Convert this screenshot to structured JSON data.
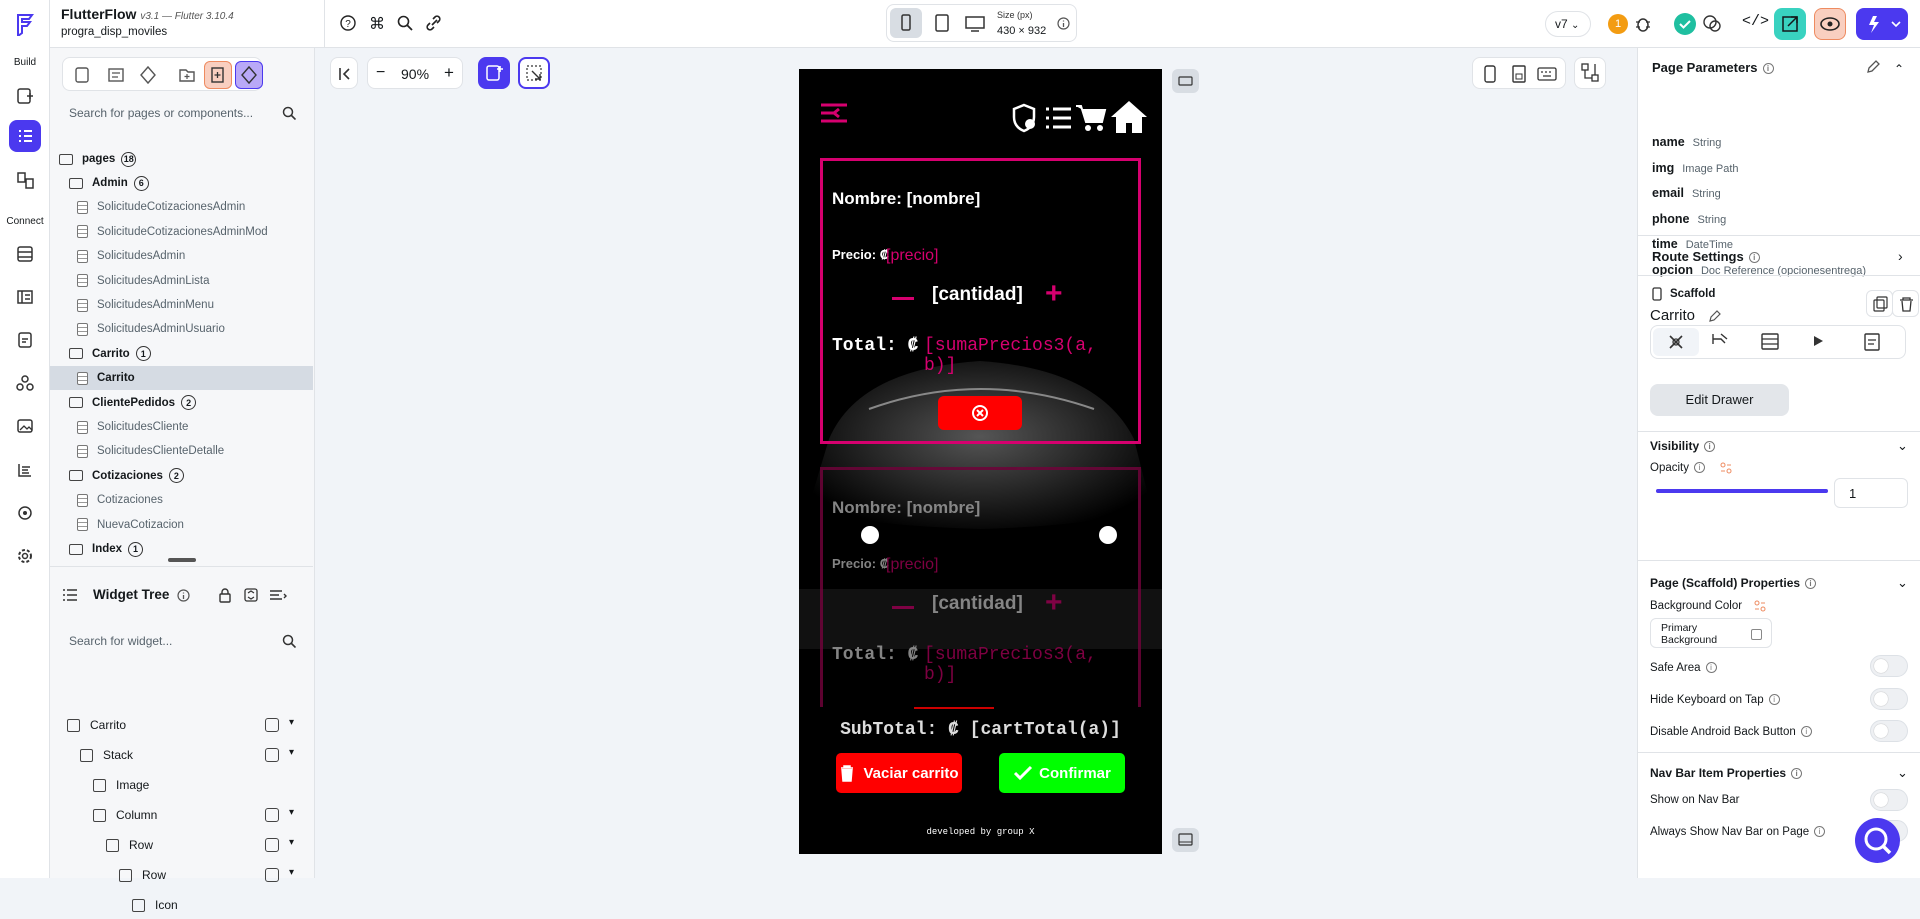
{
  "app": {
    "name": "FlutterFlow",
    "version": "v3.1 — Flutter 3.10.4",
    "project": "progra_disp_moviles"
  },
  "rail": {
    "build": "Build",
    "connect": "Connect"
  },
  "topbar": {
    "size_label": "Size (px)",
    "size_value": "430 × 932",
    "version": "v7",
    "notif_count": "1"
  },
  "pages": {
    "search_placeholder": "Search for pages or components...",
    "root_label": "pages",
    "root_count": "18",
    "items": [
      {
        "kind": "folder",
        "label": "Admin",
        "count": "6"
      },
      {
        "kind": "page",
        "label": "SolicitudeCotizacionesAdmin"
      },
      {
        "kind": "page",
        "label": "SolicitudeCotizacionesAdminMod"
      },
      {
        "kind": "page",
        "label": "SolicitudesAdmin"
      },
      {
        "kind": "page",
        "label": "SolicitudesAdminLista"
      },
      {
        "kind": "page",
        "label": "SolicitudesAdminMenu"
      },
      {
        "kind": "page",
        "label": "SolicitudesAdminUsuario"
      },
      {
        "kind": "folder",
        "label": "Carrito",
        "count": "1"
      },
      {
        "kind": "page",
        "label": "Carrito",
        "selected": true
      },
      {
        "kind": "folder",
        "label": "ClientePedidos",
        "count": "2"
      },
      {
        "kind": "page",
        "label": "SolicitudesCliente"
      },
      {
        "kind": "page",
        "label": "SolicitudesClienteDetalle"
      },
      {
        "kind": "folder",
        "label": "Cotizaciones",
        "count": "2"
      },
      {
        "kind": "page",
        "label": "Cotizaciones"
      },
      {
        "kind": "page",
        "label": "NuevaCotizacion"
      },
      {
        "kind": "folder",
        "label": "Index",
        "count": "1"
      }
    ]
  },
  "widget_tree": {
    "title": "Widget Tree",
    "search_placeholder": "Search for widget...",
    "items": [
      {
        "label": "Carrito",
        "icon": "phone-icon",
        "indent": 0
      },
      {
        "label": "Stack",
        "icon": "stack-icon",
        "indent": 1
      },
      {
        "label": "Image",
        "icon": "image-icon",
        "indent": 2
      },
      {
        "label": "Column",
        "icon": "column-icon",
        "indent": 2
      },
      {
        "label": "Row",
        "icon": "row-icon",
        "indent": 3
      },
      {
        "label": "Row",
        "icon": "row-icon",
        "indent": 4
      },
      {
        "label": "Icon",
        "icon": "gear-icon",
        "indent": 5
      }
    ]
  },
  "canvas": {
    "zoom": "90%"
  },
  "phone": {
    "card1": {
      "nombre": "Nombre: [nombre]",
      "precio_label": "Precio:",
      "colon_sign": "₡",
      "precio_value": "[precio]",
      "cantidad": "[cantidad]",
      "total_label": "Total:",
      "total_value": "[sumaPrecios3(a, b)]"
    },
    "card2": {
      "nombre": "Nombre: [nombre]",
      "precio_label": "Precio:",
      "precio_value": "[precio]",
      "cantidad": "[cantidad]",
      "total_label": "Total:",
      "total_value": "[sumaPrecios3(a, b)]"
    },
    "subtotal": "SubTotal: ₡ [cartTotal(a)]",
    "vaciar": "Vaciar carrito",
    "confirmar": "Confirmar",
    "footer": "developed by group X",
    "colors": {
      "accent": "#d6006f",
      "red": "#ff0000",
      "green": "#00ff00"
    }
  },
  "right": {
    "page_params_title": "Page Parameters",
    "params": [
      {
        "name": "name",
        "type": "String"
      },
      {
        "name": "img",
        "type": "Image Path"
      },
      {
        "name": "email",
        "type": "String"
      },
      {
        "name": "phone",
        "type": "String"
      },
      {
        "name": "time",
        "type": "DateTime"
      },
      {
        "name": "opcion",
        "type": "Doc Reference (opcionesentrega)"
      }
    ],
    "route_settings": "Route Settings",
    "scaffold_label": "Scaffold",
    "scaffold_name": "Carrito",
    "edit_drawer": "Edit Drawer",
    "visibility": "Visibility",
    "opacity_label": "Opacity",
    "opacity_value": "1",
    "opacity_level": 1.0,
    "scaffold_props": "Page (Scaffold) Properties",
    "bg_color_label": "Background Color",
    "bg_color_value": "Primary Background",
    "safe_area": "Safe Area",
    "hide_keyboard": "Hide Keyboard on Tap",
    "disable_back": "Disable Android Back Button",
    "nav_bar_props": "Nav Bar Item Properties",
    "show_nav": "Show on Nav Bar",
    "always_nav": "Always Show Nav Bar on Page"
  }
}
